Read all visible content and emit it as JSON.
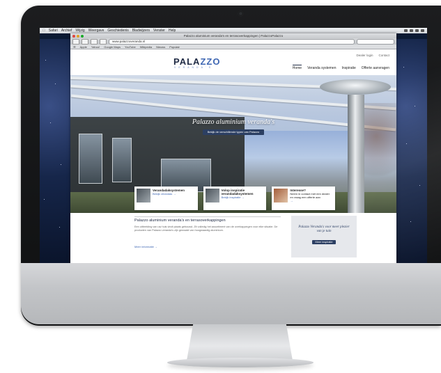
{
  "mac_menubar": {
    "items": [
      "Safari",
      "Archief",
      "Wijzig",
      "Weergave",
      "Geschiedenis",
      "Bladwijzers",
      "Venster",
      "Help"
    ]
  },
  "browser": {
    "window_title": "Palazzo aluminium veranda's en terrasoverkappingen | PalazzoPalazzo",
    "url": "www.palazzoveranda.nl",
    "bookmarks": [
      "Apple",
      "Yahoo!",
      "Google Maps",
      "YouTube",
      "Wikipedia",
      "Nieuws",
      "Populair"
    ]
  },
  "site": {
    "logo": {
      "part1": "PALA",
      "part2": "ZZO",
      "tagline": "VERANDA'S"
    },
    "top_links": [
      "Dealer login",
      "Contact"
    ],
    "nav": [
      "Home",
      "Veranda systemen",
      "Inspiratie",
      "Offerte aanvragen"
    ],
    "hero": {
      "title": "Palazzo aluminium veranda's",
      "button": "Bekijk de verschillende typen van Palazzo"
    },
    "features": [
      {
        "title": "Verandadaksystemen",
        "link": "Bekijk verandas →"
      },
      {
        "title": "Volop inspiratie verandadaksystemen",
        "link": "Bekijk inspiratie →"
      },
      {
        "title": "Interesse?",
        "text": "Neem in contact met een dealer en vraag een offerte aan",
        "link": "→"
      }
    ],
    "content": {
      "title": "Palazzo aluminium veranda's en terrasoverkappingen",
      "body": "Een uitbreiding van uw huis vindt plaats gebouwd. Zit volledig het assortiment van de overkappingen voor elke situatie. De producten van Palazzo veranda's zijn gemaakt van hoogwaardig aluminium.",
      "more": "Meer informatie →"
    },
    "aside": {
      "text": "Palazzo Veranda's voor meer plezier van je tuin",
      "button": "Meer inspiratie"
    }
  }
}
